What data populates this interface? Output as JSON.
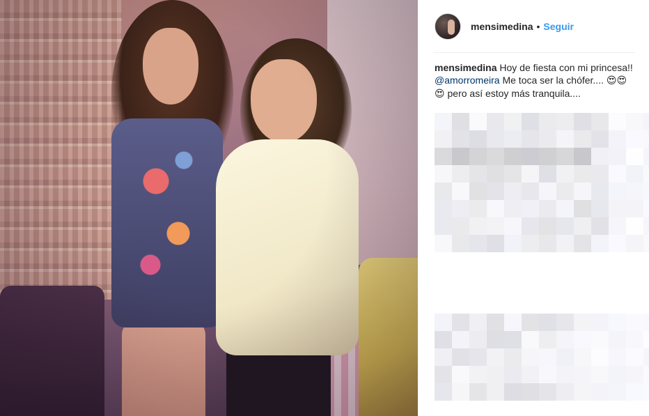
{
  "post": {
    "image_alt": "Foto de dos mujeres posando juntas en una habitación"
  },
  "header": {
    "username": "mensimedina",
    "separator": "•",
    "follow_label": "Seguir"
  },
  "caption": {
    "username": "mensimedina",
    "text_before": "Hoy de fiesta con mi princesa!! ",
    "mention": "@amorromeira",
    "text_after": " Me toca ser la chófer.... ",
    "emojis": "😍😍😍",
    "text_end": " pero así estoy más tranquila...."
  },
  "colors": {
    "follow": "#3897f0",
    "text": "#262626",
    "divider": "#efefef"
  },
  "icons": {
    "avatar": "profile-avatar"
  }
}
